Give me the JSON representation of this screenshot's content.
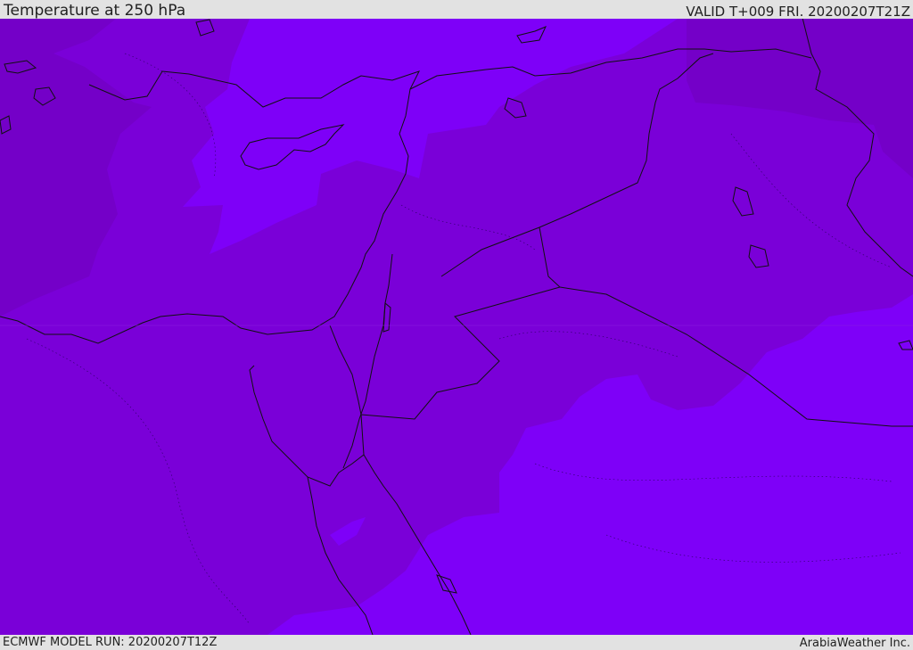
{
  "header": {
    "title": "Temperature at 250 hPa",
    "valid": "VALID T+009 FRI. 20200207T21Z"
  },
  "footer": {
    "model_run": "ECMWF MODEL RUN: 20200207T12Z",
    "credit": "ArabiaWeather Inc."
  },
  "map": {
    "region": "Eastern Mediterranean and Middle East",
    "colors": {
      "warm_band": "#7400c8",
      "mid_band": "#7a00d8",
      "cold_band": "#7e00f8",
      "coastline": "#111111"
    }
  }
}
